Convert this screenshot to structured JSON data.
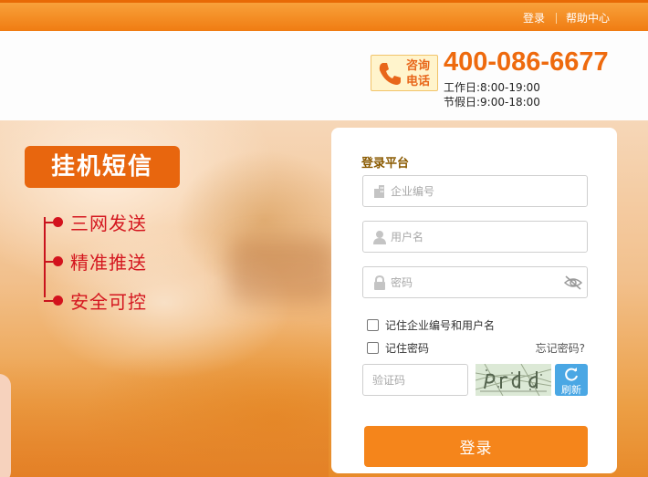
{
  "topbar": {
    "login_link": "登录",
    "help_link": "帮助中心"
  },
  "header": {
    "phone_badge": {
      "line1": "咨询",
      "line2": "电话"
    },
    "hotline": "400-086-6677",
    "hours_workday": "工作日:8:00-19:00",
    "hours_holiday": "节假日:9:00-18:00"
  },
  "banner": {
    "slogan": "挂机短信",
    "features": [
      "三网发送",
      "精准推送",
      "安全可控"
    ]
  },
  "login": {
    "title": "登录平台",
    "company_placeholder": "企业编号",
    "username_placeholder": "用户名",
    "password_placeholder": "密码",
    "remember_company_user": "记住企业编号和用户名",
    "remember_password": "记住密码",
    "forgot_password": "忘记密码?",
    "captcha_placeholder": "验证码",
    "refresh_label": "刷新",
    "submit_label": "登录"
  },
  "colors": {
    "accent_orange": "#f5851b",
    "topbar_orange": "#f07c12",
    "feature_red": "#d4161f",
    "refresh_blue": "#4aa7e4"
  }
}
